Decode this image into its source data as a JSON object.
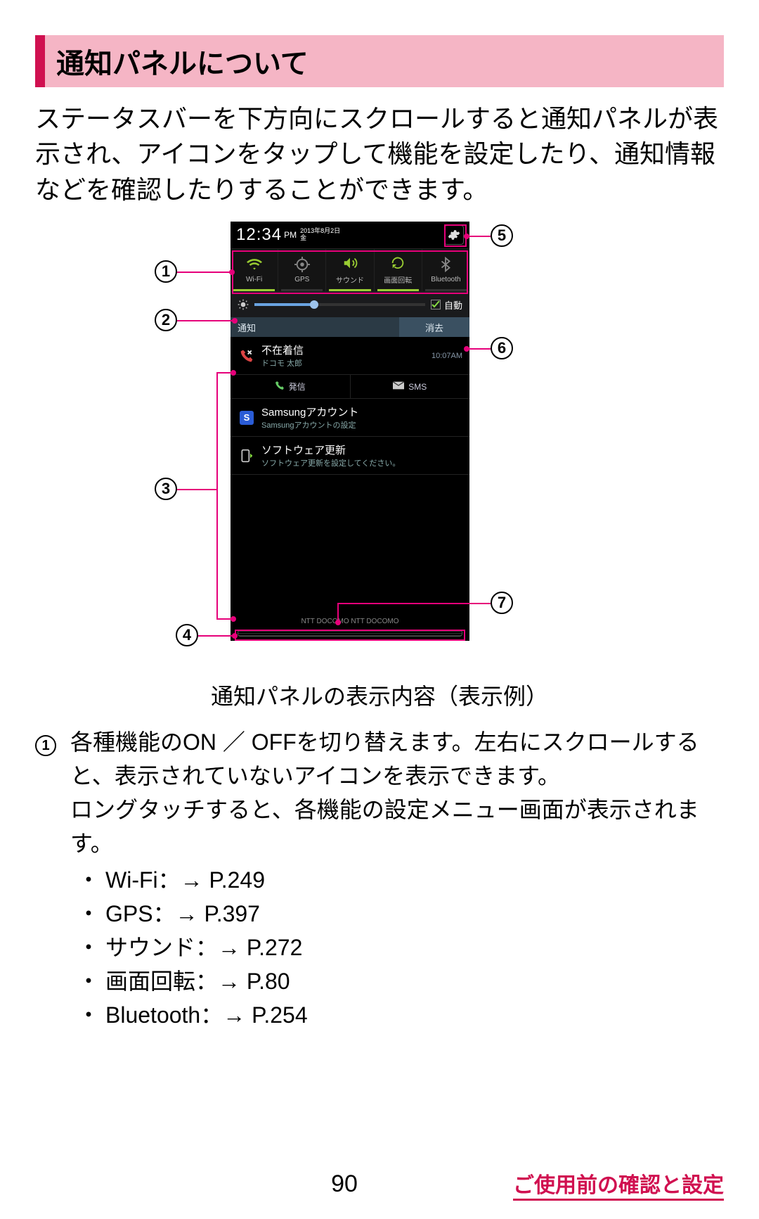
{
  "section_title": "通知パネルについて",
  "intro": "ステータスバーを下方向にスクロールすると通知パネルが表示され、アイコンをタップして機能を設定したり、通知情報などを確認したりすることができます。",
  "phone": {
    "time": "12:34",
    "ampm": "PM",
    "dow": "金",
    "date": "2013年8月2日",
    "toggles": [
      {
        "label": "Wi-Fi",
        "icon": "wifi",
        "on": true
      },
      {
        "label": "GPS",
        "icon": "gps",
        "on": false
      },
      {
        "label": "サウンド",
        "icon": "sound",
        "on": true
      },
      {
        "label": "画面回転",
        "icon": "rotate",
        "on": true
      },
      {
        "label": "Bluetooth",
        "icon": "bluetooth",
        "on": false
      }
    ],
    "brightness": {
      "auto_label": "自動",
      "auto_checked": true,
      "value_pct": 35
    },
    "notif_header_left": "通知",
    "notif_header_right": "消去",
    "notifications": [
      {
        "icon": "missed-call",
        "title": "不在着信",
        "sub": "ドコモ 太郎",
        "time": "10:07AM",
        "actions": [
          {
            "icon": "phone",
            "label": "発信"
          },
          {
            "icon": "sms",
            "label": "SMS"
          }
        ]
      },
      {
        "icon": "samsung",
        "title": "Samsungアカウント",
        "sub": "Samsungアカウントの設定"
      },
      {
        "icon": "update",
        "title": "ソフトウェア更新",
        "sub": "ソフトウェア更新を設定してください。"
      }
    ],
    "carrier": "NTT DOCOMO NTT DOCOMO"
  },
  "callouts": {
    "c1": "1",
    "c2": "2",
    "c3": "3",
    "c4": "4",
    "c5": "5",
    "c6": "6",
    "c7": "7"
  },
  "caption": "通知パネルの表示内容（表示例）",
  "desc1_marker": "1",
  "desc1_body": "各種機能のON ／ OFFを切り替えます。左右にスクロールすると、表示されていないアイコンを表示できます。\nロングタッチすると、各機能の設定メニュー画面が表示されます。",
  "desc1_sub": [
    "Wi-Fi：→ P.249",
    "GPS：→ P.397",
    "サウンド：→ P.272",
    "画面回転：→ P.80",
    "Bluetooth：→ P.254"
  ],
  "footer": {
    "page": "90",
    "chapter": "ご使用前の確認と設定"
  }
}
